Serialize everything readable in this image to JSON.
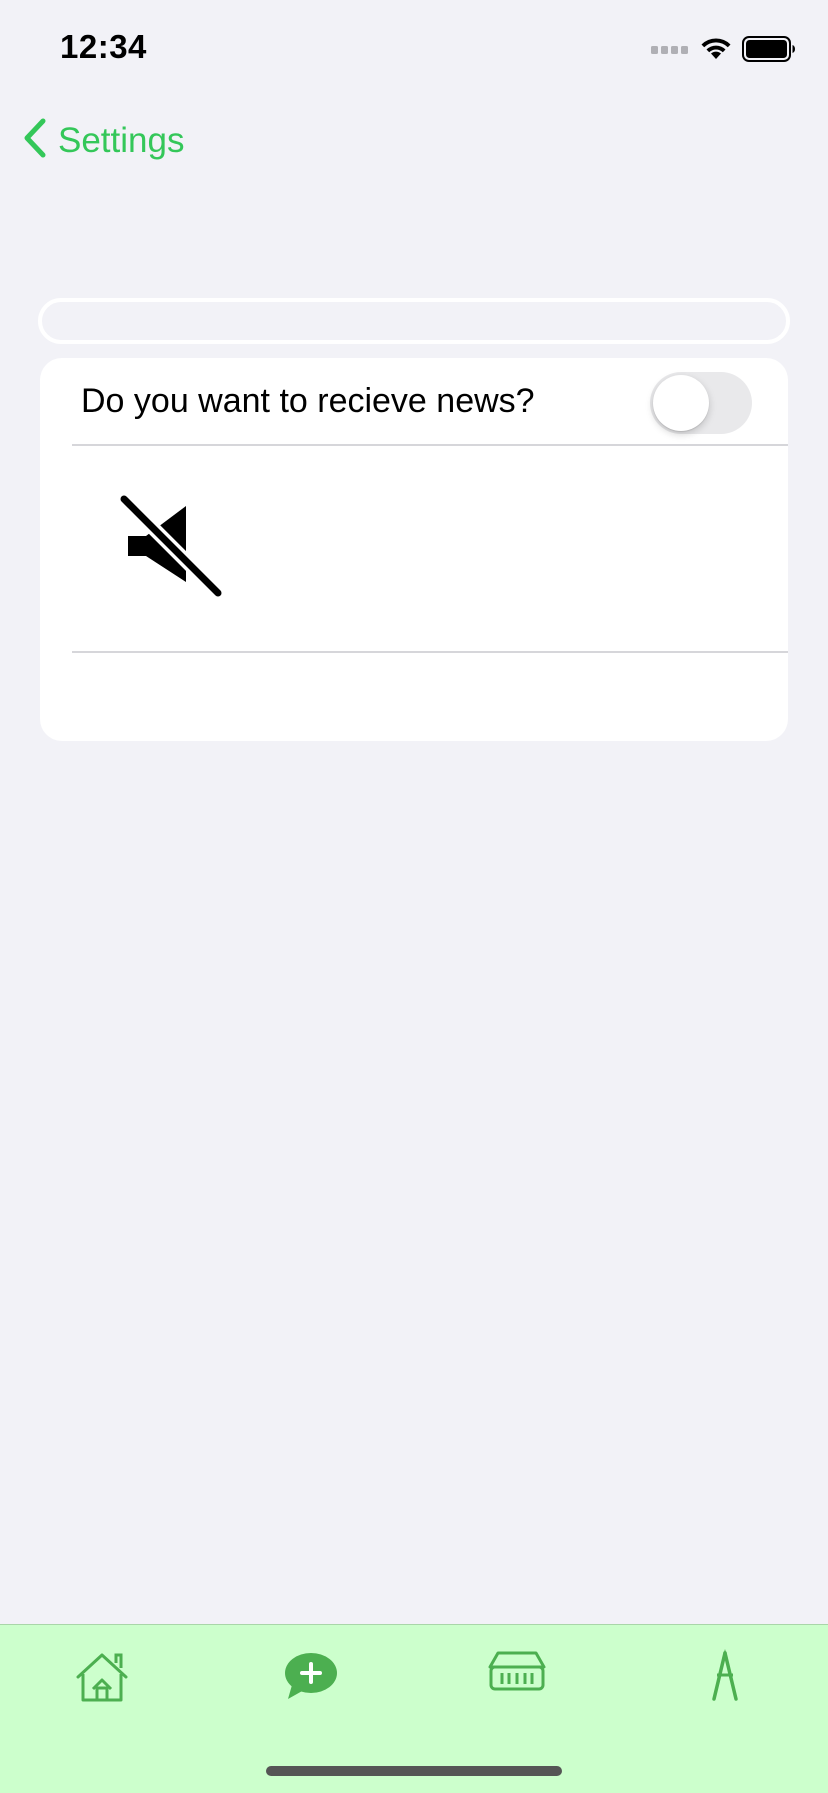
{
  "status_bar": {
    "time": "12:34"
  },
  "nav": {
    "back_label": "Settings"
  },
  "settings": {
    "news_label": "Do you want to recieve news?",
    "news_toggle_on": false
  },
  "tab_bar": {
    "items": [
      {
        "icon": "home-icon"
      },
      {
        "icon": "chat-add-icon"
      },
      {
        "icon": "storefront-icon"
      },
      {
        "icon": "compass-drawing-icon"
      }
    ]
  },
  "colors": {
    "accent": "#34c759",
    "background": "#f2f2f7",
    "tab_bar_background": "#ccffcc",
    "tab_icon": "#4caf50"
  }
}
